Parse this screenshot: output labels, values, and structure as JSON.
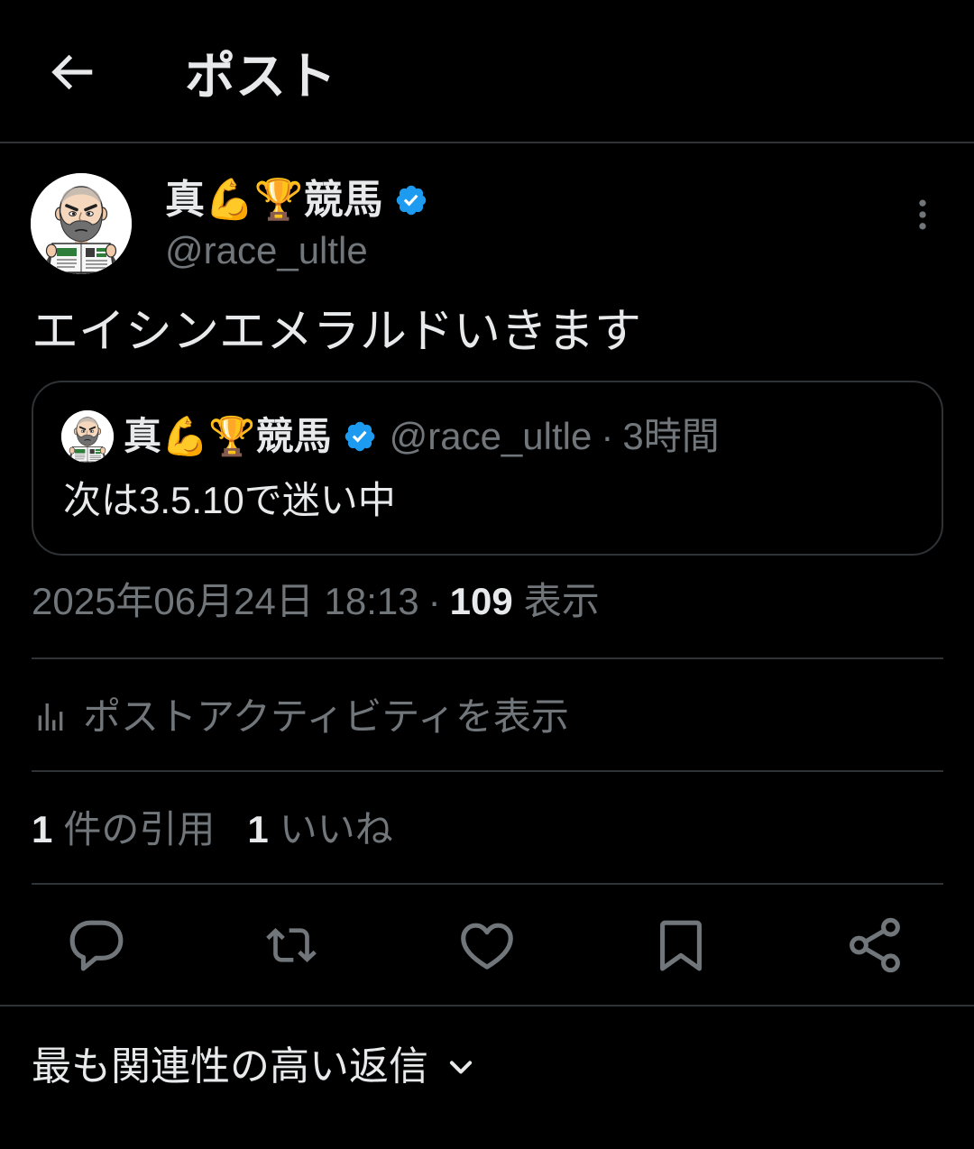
{
  "header": {
    "title": "ポスト",
    "back_icon": "back-arrow-icon"
  },
  "post": {
    "author": {
      "name": "真💪🏆競馬",
      "handle": "@race_ultle",
      "verified": true,
      "avatar": "bald-bearded-man-with-newspaper-avatar"
    },
    "more_icon": "more-vertical-icon",
    "text": "エイシンエメラルドいきます",
    "quoted_post": {
      "author": {
        "name": "真💪🏆競馬",
        "handle": "@race_ultle",
        "verified": true
      },
      "separator": "·",
      "relative_time": "3時間",
      "text": "次は3.5.10で迷い中"
    },
    "timestamp": "2025年06月24日 18:13",
    "separator": "·",
    "views": {
      "count": "109",
      "label": "表示"
    },
    "activity_link": {
      "label": "ポストアクティビティを表示",
      "icon": "analytics-icon"
    },
    "stats": [
      {
        "count": "1",
        "label": "件の引用"
      },
      {
        "count": "1",
        "label": "いいね"
      }
    ],
    "action_icons": [
      "reply-icon",
      "retweet-icon",
      "like-icon",
      "bookmark-icon",
      "share-icon"
    ]
  },
  "replies_sort": {
    "label": "最も関連性の高い返信",
    "icon": "chevron-down-icon"
  },
  "colors": {
    "background": "#000000",
    "text_primary": "#e7e9ea",
    "text_secondary": "#71767b",
    "divider": "#2f3336",
    "verified": "#1d9bf0"
  }
}
